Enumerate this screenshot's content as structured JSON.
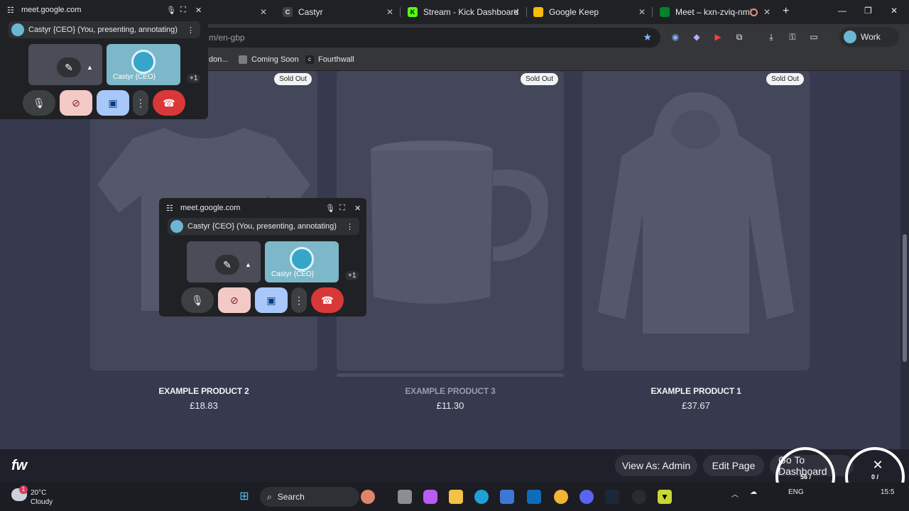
{
  "browser": {
    "tabs": [
      {
        "label": "",
        "close": "✕"
      },
      {
        "label": "Castyr",
        "close": "✕"
      },
      {
        "label": "Stream - Kick Dashboard",
        "close": "✕"
      },
      {
        "label": "Google Keep",
        "close": "✕"
      },
      {
        "label": "Meet – kxn-zviq-nmi",
        "close": "✕"
      }
    ],
    "new_tab": "+",
    "url_fragment": "m/en-gbp",
    "profile_label": "Work",
    "bookmarks": [
      "don...",
      "Coming Soon",
      "Fourthwall"
    ]
  },
  "products": [
    {
      "name": "EXAMPLE PRODUCT 2",
      "price": "£18.83",
      "badge": "Sold Out"
    },
    {
      "name": "EXAMPLE PRODUCT 3",
      "price": "£11.30",
      "badge": "Sold Out"
    },
    {
      "name": "EXAMPLE PRODUCT 1",
      "price": "£37.67",
      "badge": "Sold Out"
    }
  ],
  "admin_bar": {
    "logo": "fw",
    "view_as": "View As: Admin",
    "edit_page": "Edit Page",
    "go_dashboard": "Go To Dashboard",
    "counter_left": "56 /",
    "counter_right": "0 /"
  },
  "meet_pip": {
    "domain": "meet.google.com",
    "presenter": "Castyr {CEO} (You, presenting, annotating)",
    "tile_name": "Castyr {CEO}",
    "more_count": "+1"
  },
  "taskbar": {
    "weather_badge": "1",
    "temperature": "20°C",
    "condition": "Cloudy",
    "search": "Search",
    "language": "ENG",
    "time": "15:5"
  },
  "colors": {
    "page_bg": "#373a4e",
    "card_bg": "#44475a",
    "end_call": "#d93838",
    "mic_off": "#f3c9c6",
    "present": "#a8c7fa"
  }
}
